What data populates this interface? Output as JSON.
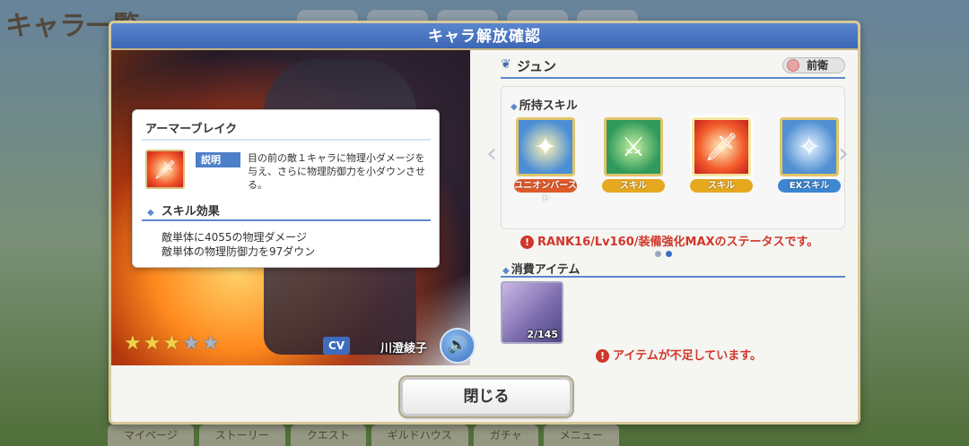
{
  "background": {
    "title": "キャラ一覧",
    "bottom_tabs": [
      "マイページ",
      "ストーリー",
      "クエスト",
      "ギルドハウス",
      "ガチャ",
      "メニュー"
    ]
  },
  "modal": {
    "title": "キャラ解放確認",
    "character": {
      "name": "ジュン",
      "position": "前衛",
      "stars": [
        true,
        true,
        true,
        false,
        false
      ],
      "cv_label": "CV",
      "voice_actor": "川澄綾子"
    },
    "skills": {
      "label": "所持スキル",
      "items": [
        {
          "tag": "ユニオンバースト",
          "icon": "union-burst-icon",
          "selected": false
        },
        {
          "tag": "スキル",
          "icon": "shield-skill-icon",
          "selected": false
        },
        {
          "tag": "スキル",
          "icon": "armor-break-icon",
          "selected": true
        },
        {
          "tag": "EXスキル",
          "icon": "ex-skill-icon",
          "selected": false
        }
      ],
      "page_dots": 2,
      "active_dot": 1
    },
    "status_note": "RANK16/Lv160/装備強化MAXのステータスです。",
    "items": {
      "label": "消費アイテム",
      "count": "2/145",
      "insufficient_message": "アイテムが不足しています。"
    },
    "close_label": "閉じる"
  },
  "tooltip": {
    "title": "アーマーブレイク",
    "desc_label": "説明",
    "description": "目の前の敵１キャラに物理小ダメージを与え、さらに物理防御力を小ダウンさせる。",
    "effect_label": "スキル効果",
    "effects": [
      "敵単体に4055の物理ダメージ",
      "敵単体の物理防御力を97ダウン"
    ]
  },
  "colors": {
    "header_blue": "#3c66b4",
    "warning_red": "#d0362a",
    "gold_border": "#d8c99a"
  }
}
